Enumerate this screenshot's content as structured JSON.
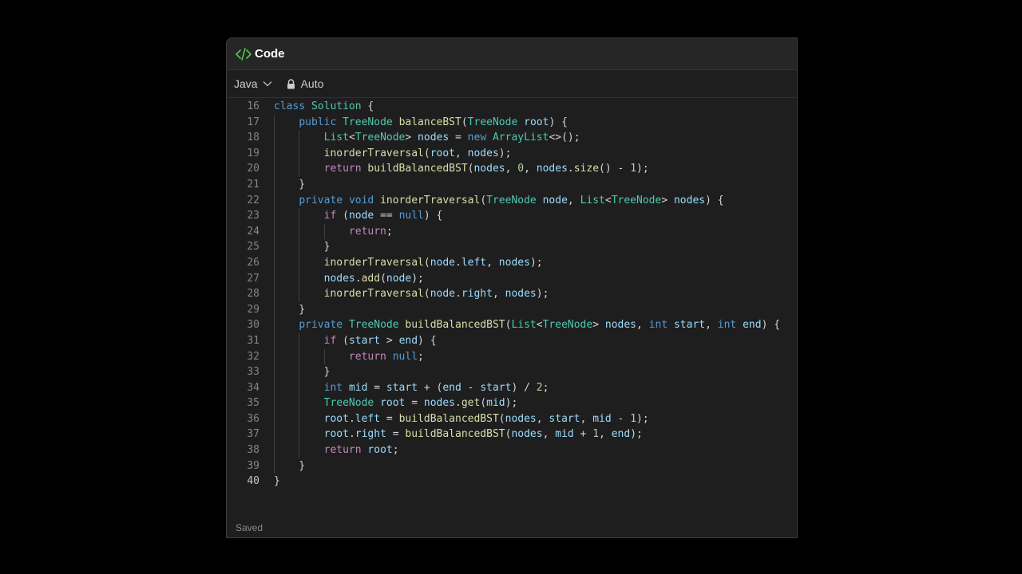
{
  "window": {
    "title": "Code",
    "icon": "code-brackets-icon",
    "accent_color": "#4ec94e"
  },
  "toolbar": {
    "language": "Java",
    "mode_label": "Auto",
    "mode_icon": "lock-icon"
  },
  "editor": {
    "active_line": 40,
    "lines": [
      {
        "number": "16",
        "text": "class Solution {"
      },
      {
        "number": "17",
        "text": "    public TreeNode balanceBST(TreeNode root) {"
      },
      {
        "number": "18",
        "text": "        List<TreeNode> nodes = new ArrayList<>();"
      },
      {
        "number": "19",
        "text": "        inorderTraversal(root, nodes);"
      },
      {
        "number": "20",
        "text": "        return buildBalancedBST(nodes, 0, nodes.size() - 1);"
      },
      {
        "number": "21",
        "text": "    }"
      },
      {
        "number": "22",
        "text": "    private void inorderTraversal(TreeNode node, List<TreeNode> nodes) {"
      },
      {
        "number": "23",
        "text": "        if (node == null) {"
      },
      {
        "number": "24",
        "text": "            return;"
      },
      {
        "number": "25",
        "text": "        }"
      },
      {
        "number": "26",
        "text": "        inorderTraversal(node.left, nodes);"
      },
      {
        "number": "27",
        "text": "        nodes.add(node);"
      },
      {
        "number": "28",
        "text": "        inorderTraversal(node.right, nodes);"
      },
      {
        "number": "29",
        "text": "    }"
      },
      {
        "number": "30",
        "text": "    private TreeNode buildBalancedBST(List<TreeNode> nodes, int start, int end) {"
      },
      {
        "number": "31",
        "text": "        if (start > end) {"
      },
      {
        "number": "32",
        "text": "            return null;"
      },
      {
        "number": "33",
        "text": "        }"
      },
      {
        "number": "34",
        "text": "        int mid = start + (end - start) / 2;"
      },
      {
        "number": "35",
        "text": "        TreeNode root = nodes.get(mid);"
      },
      {
        "number": "36",
        "text": "        root.left = buildBalancedBST(nodes, start, mid - 1);"
      },
      {
        "number": "37",
        "text": "        root.right = buildBalancedBST(nodes, mid + 1, end);"
      },
      {
        "number": "38",
        "text": "        return root;"
      },
      {
        "number": "39",
        "text": "    }"
      },
      {
        "number": "40",
        "text": "}"
      }
    ]
  },
  "status": {
    "text": "Saved"
  }
}
